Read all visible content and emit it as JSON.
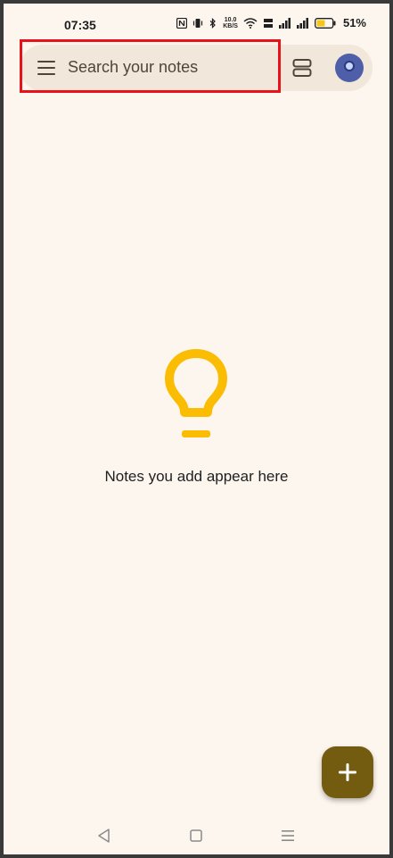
{
  "status_bar": {
    "time": "07:35",
    "net_speed_value": "10.0",
    "net_speed_unit": "KB/S",
    "battery_percent": "51%"
  },
  "search": {
    "placeholder": "Search your notes"
  },
  "empty_state": {
    "message": "Notes you add appear here"
  },
  "colors": {
    "background": "#fdf6ee",
    "search_bar": "#f1e7db",
    "highlight": "#e8131a",
    "bulb": "#fbbc04",
    "fab": "#735c10",
    "avatar": "#4e5ea8"
  },
  "icons": {
    "menu": "hamburger-menu-icon",
    "layout": "list-view-icon",
    "empty": "lightbulb-icon",
    "fab": "plus-icon",
    "nav_back": "back-triangle-icon",
    "nav_home": "home-square-icon",
    "nav_recents": "recents-menu-icon"
  }
}
